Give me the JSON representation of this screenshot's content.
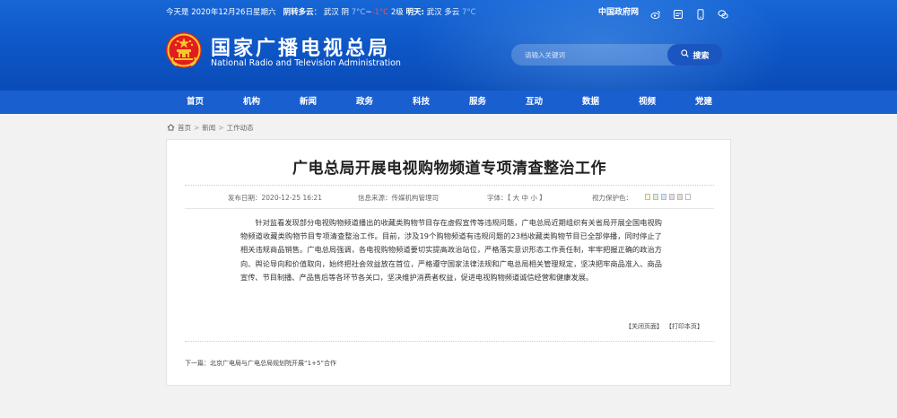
{
  "topbar": {
    "date": "今天是 2020年12月26日星期六",
    "weather_label_1": "阴转多云",
    "weather_city_1": "武汉",
    "weather_1": "阴",
    "temp_1": "7°C",
    "temp_1_high": "-1°C",
    "wind": "2级",
    "weather_label_2": "明天:",
    "weather_city_2": "武汉",
    "weather_2": "多云",
    "temp_2": "7°C",
    "gov_link": "中国政府网",
    "icons": [
      "weibo-icon",
      "wechat-icon",
      "mobile-icon",
      "chat-icon"
    ]
  },
  "header": {
    "title_cn": "国家广播电视总局",
    "title_en": "National Radio and Television Administration"
  },
  "search": {
    "placeholder": "请输入关键词",
    "button": "搜索"
  },
  "nav": [
    "首页",
    "机构",
    "新闻",
    "政务",
    "科技",
    "服务",
    "互动",
    "数据",
    "视频",
    "党建"
  ],
  "breadcrumb": [
    "首页",
    "新闻",
    "工作动态"
  ],
  "article": {
    "title": "广电总局开展电视购物频道专项清查整治工作",
    "publish": "发布日期：2020-12-25 16:21",
    "source": "信息来源：传媒机构管理司",
    "font_size": "字体：【 大  中  小 】",
    "eye_protect": "视力保护色：",
    "swatch_colors": [
      "#fff7c7",
      "#d8f0d0",
      "#d3e6fb",
      "#e7d8f3",
      "#ead8d8",
      "#ffffff"
    ],
    "body": "针对监看发现部分电视购物频道播出的收藏类购物节目存在虚假宣传等违规问题，广电总局近期组织有关省局开展全国电视购物频道收藏类购物节目专项清查整治工作。目前，涉及19个购物频道有违规问题的23档收藏类购物节目已全部停播，同时停止了相关违规商品销售。广电总局强调，各电视购物频道要切实提高政治站位，严格落实意识形态工作责任制，牢牢把握正确的政治方向、舆论导向和价值取向，始终把社会效益放在首位，严格遵守国家法律法规和广电总局相关管理规定，坚决把牢商品准入、商品宣传、节目制播、产品售后等各环节各关口，坚决维护消费者权益，促进电视购物频道诚信经营和健康发展。",
    "close_page": "【关闭页面】",
    "print_page": "【打印本页】",
    "next": "下一篇：北京广电局与广电总局规划院开展“1+5”合作"
  }
}
